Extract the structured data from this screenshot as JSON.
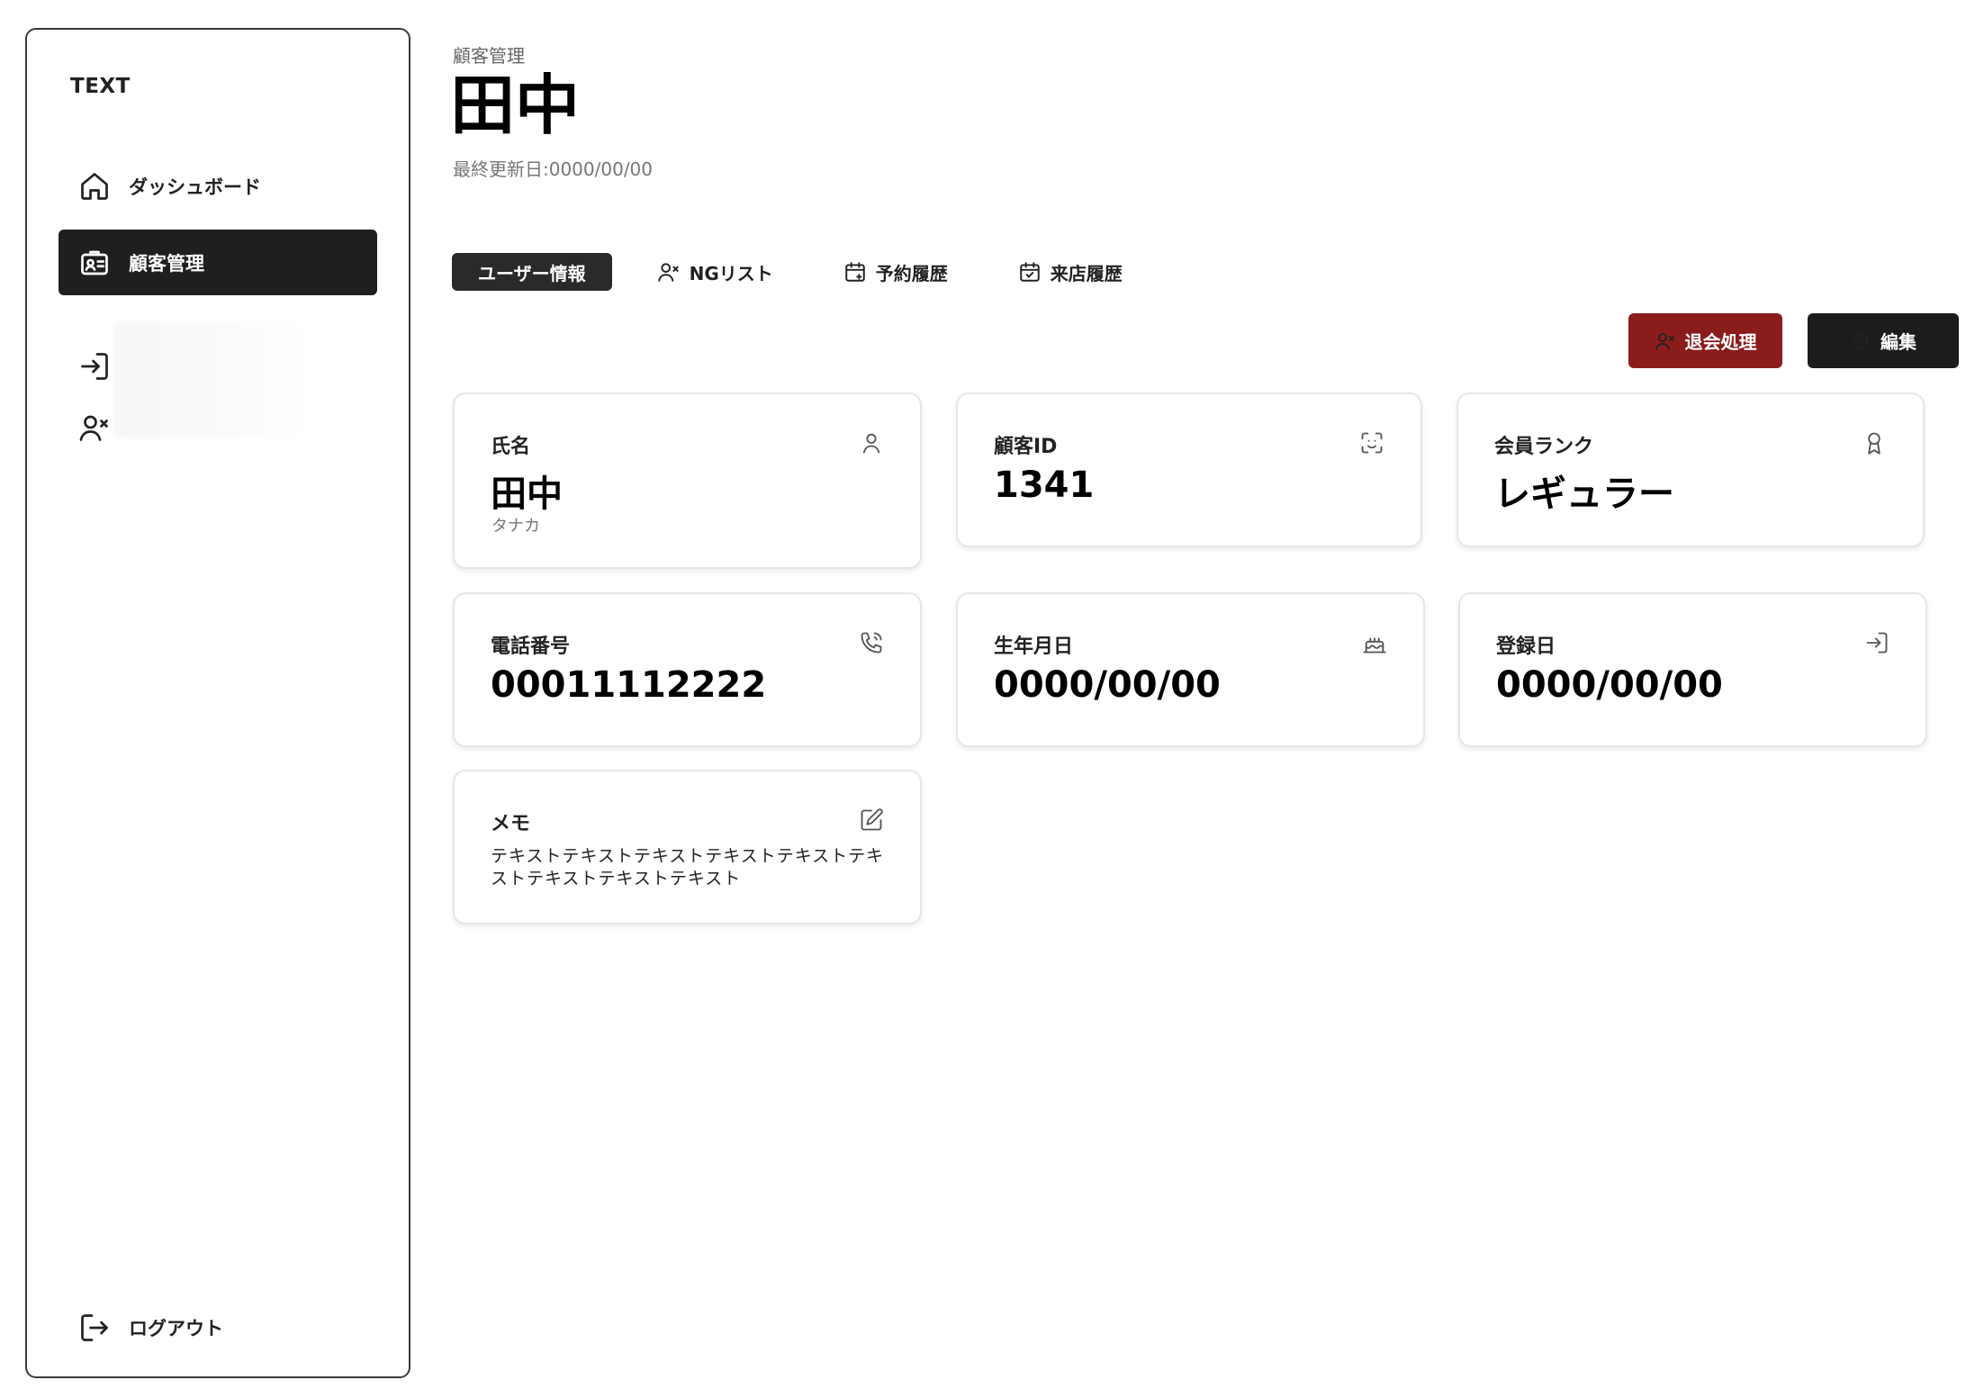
{
  "sidebar": {
    "brand": "TEXT",
    "items": [
      {
        "label": "ダッシュボード",
        "icon": "home-icon"
      },
      {
        "label": "顧客管理",
        "icon": "id-card-icon",
        "active": true
      },
      {
        "label": "",
        "icon": "login-icon"
      },
      {
        "label": "",
        "icon": "user-x-icon"
      }
    ],
    "logout_label": "ログアウト"
  },
  "header": {
    "breadcrumb": "顧客管理",
    "title": "田中",
    "updated": "最終更新日:0000/00/00"
  },
  "tabs": [
    {
      "label": "ユーザー情報",
      "active": true
    },
    {
      "label": "NGリスト",
      "icon": "user-x-icon"
    },
    {
      "label": "予約履歴",
      "icon": "calendar-plus-icon"
    },
    {
      "label": "来店履歴",
      "icon": "calendar-check-icon"
    }
  ],
  "actions": {
    "withdraw_label": "退会処理",
    "edit_label": "編集",
    "withdraw_color": "#8b1c1c",
    "edit_color": "#1c1c1c"
  },
  "cards": {
    "name": {
      "label": "氏名",
      "value": "田中",
      "sub": "タナカ",
      "icon": "user-icon"
    },
    "customer_id": {
      "label": "顧客ID",
      "value": "1341",
      "icon": "scan-face-icon"
    },
    "rank": {
      "label": "会員ランク",
      "value": "レギュラー",
      "icon": "award-icon"
    },
    "phone": {
      "label": "電話番号",
      "value": "00011112222",
      "icon": "phone-icon"
    },
    "birthday": {
      "label": "生年月日",
      "value": "0000/00/00",
      "icon": "cake-icon"
    },
    "registered": {
      "label": "登録日",
      "value": "0000/00/00",
      "icon": "login-icon"
    },
    "memo": {
      "label": "メモ",
      "value": "テキストテキストテキストテキストテキストテキストテキストテキストテキスト",
      "icon": "edit-icon"
    }
  }
}
